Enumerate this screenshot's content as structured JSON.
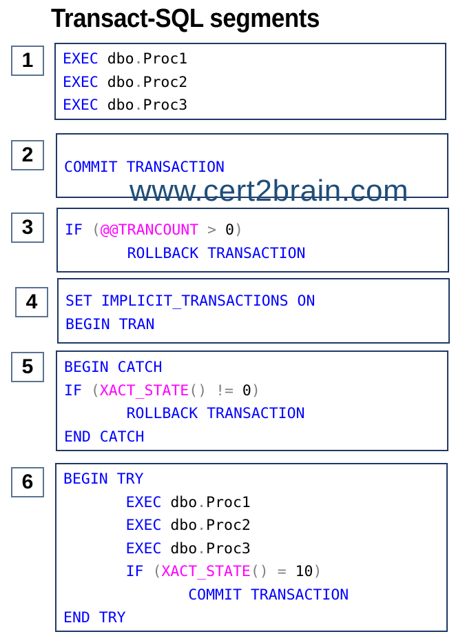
{
  "title": "Transact-SQL segments",
  "watermark": "www.cert2brain.com",
  "colors": {
    "keyword": "#0000ff",
    "identifier": "#000000",
    "operator": "#808080",
    "function": "#ff00ff",
    "box_border": "#1f3864",
    "number_border": "#5a7290",
    "watermark": "#1f4e79"
  },
  "segments": [
    {
      "number": "1",
      "lines": [
        [
          {
            "t": "kw",
            "v": "EXEC"
          },
          {
            "t": "ident",
            "v": " dbo"
          },
          {
            "t": "op",
            "v": "."
          },
          {
            "t": "ident",
            "v": "Proc1"
          }
        ],
        [
          {
            "t": "kw",
            "v": "EXEC"
          },
          {
            "t": "ident",
            "v": " dbo"
          },
          {
            "t": "op",
            "v": "."
          },
          {
            "t": "ident",
            "v": "Proc2"
          }
        ],
        [
          {
            "t": "kw",
            "v": "EXEC"
          },
          {
            "t": "ident",
            "v": " dbo"
          },
          {
            "t": "op",
            "v": "."
          },
          {
            "t": "ident",
            "v": "Proc3"
          }
        ]
      ]
    },
    {
      "number": "2",
      "lines": [
        [
          {
            "t": "kw",
            "v": "COMMIT TRANSACTION"
          }
        ]
      ]
    },
    {
      "number": "3",
      "lines": [
        [
          {
            "t": "kw",
            "v": "IF "
          },
          {
            "t": "op",
            "v": "("
          },
          {
            "t": "fn",
            "v": "@@TRANCOUNT"
          },
          {
            "t": "op",
            "v": " > "
          },
          {
            "t": "ident",
            "v": "0"
          },
          {
            "t": "op",
            "v": ")"
          }
        ],
        [
          {
            "t": "kw",
            "v": "       ROLLBACK TRANSACTION"
          }
        ]
      ]
    },
    {
      "number": "4",
      "lines": [
        [
          {
            "t": "kw",
            "v": "SET IMPLICIT_TRANSACTIONS ON"
          }
        ],
        [
          {
            "t": "kw",
            "v": "BEGIN TRAN"
          }
        ]
      ]
    },
    {
      "number": "5",
      "lines": [
        [
          {
            "t": "kw",
            "v": "BEGIN CATCH"
          }
        ],
        [
          {
            "t": "kw",
            "v": "IF "
          },
          {
            "t": "op",
            "v": "("
          },
          {
            "t": "fn",
            "v": "XACT_STATE"
          },
          {
            "t": "op",
            "v": "() != "
          },
          {
            "t": "ident",
            "v": "0"
          },
          {
            "t": "op",
            "v": ")"
          }
        ],
        [
          {
            "t": "kw",
            "v": "       ROLLBACK TRANSACTION"
          }
        ],
        [
          {
            "t": "kw",
            "v": "END CATCH"
          }
        ]
      ]
    },
    {
      "number": "6",
      "lines": [
        [
          {
            "t": "kw",
            "v": "BEGIN TRY"
          }
        ],
        [
          {
            "t": "kw",
            "v": "       EXEC"
          },
          {
            "t": "ident",
            "v": " dbo"
          },
          {
            "t": "op",
            "v": "."
          },
          {
            "t": "ident",
            "v": "Proc1"
          }
        ],
        [
          {
            "t": "kw",
            "v": "       EXEC"
          },
          {
            "t": "ident",
            "v": " dbo"
          },
          {
            "t": "op",
            "v": "."
          },
          {
            "t": "ident",
            "v": "Proc2"
          }
        ],
        [
          {
            "t": "kw",
            "v": "       EXEC"
          },
          {
            "t": "ident",
            "v": " dbo"
          },
          {
            "t": "op",
            "v": "."
          },
          {
            "t": "ident",
            "v": "Proc3"
          }
        ],
        [
          {
            "t": "kw",
            "v": "       IF "
          },
          {
            "t": "op",
            "v": "("
          },
          {
            "t": "fn",
            "v": "XACT_STATE"
          },
          {
            "t": "op",
            "v": "() = "
          },
          {
            "t": "ident",
            "v": "10"
          },
          {
            "t": "op",
            "v": ")"
          }
        ],
        [
          {
            "t": "kw",
            "v": "              COMMIT TRANSACTION"
          }
        ],
        [
          {
            "t": "kw",
            "v": "END TRY"
          }
        ]
      ]
    }
  ]
}
